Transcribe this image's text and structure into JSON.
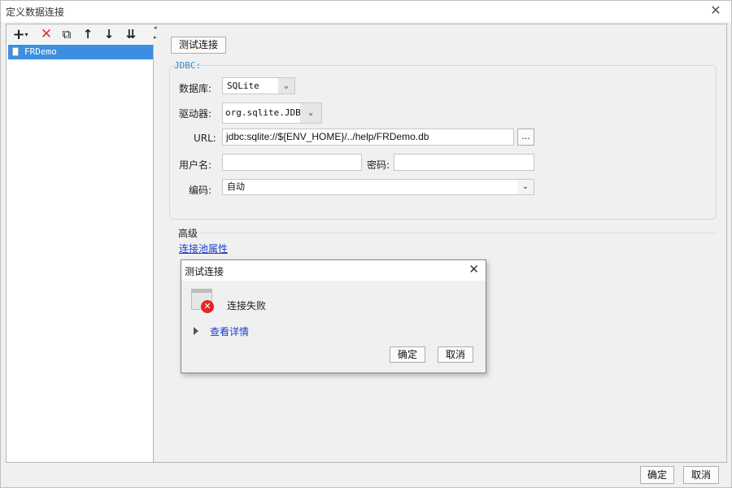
{
  "window": {
    "title": "定义数据连接",
    "close_glyph": "✕"
  },
  "toolbar": {
    "add_glyph": "+",
    "add_dropdown_glyph": "▾",
    "delete_glyph": "✕",
    "copy_glyph": "⧉",
    "move_up_glyph": "↑",
    "move_down_glyph": "↓",
    "sort_glyph": "⇊",
    "collapse_left_glyph": "◂",
    "collapse_right_glyph": "▸"
  },
  "connections": [
    {
      "name": "FRDemo",
      "selected": true
    }
  ],
  "test_button_label": "测试连接",
  "jdbc": {
    "group_label": "JDBC:",
    "database_label": "数据库:",
    "database_value": "SQLite",
    "driver_label": "驱动器:",
    "driver_value": "org.sqlite.JDBC",
    "url_label": "URL:",
    "url_value": "jdbc:sqlite://${ENV_HOME}/../help/FRDemo.db",
    "browse_label": "...",
    "username_label": "用户名:",
    "username_value": "",
    "password_label": "密码:",
    "password_value": "",
    "encoding_label": "编码:",
    "encoding_value": "自动",
    "dropdown_glyph": "⌄"
  },
  "advanced": {
    "label": "高级",
    "pool_link": "连接池属性"
  },
  "footer": {
    "ok_label": "确定",
    "cancel_label": "取消"
  },
  "dialog": {
    "title": "测试连接",
    "close_glyph": "✕",
    "message": "连接失败",
    "details_link": "查看详情",
    "ok_label": "确定",
    "cancel_label": "取消",
    "error_glyph": "✕"
  },
  "colors": {
    "selection": "#3c8fe0",
    "link": "#1a3fcc",
    "group_label": "#2b8ad0",
    "error_red": "#e0252b",
    "delete_red": "#e0332e"
  }
}
